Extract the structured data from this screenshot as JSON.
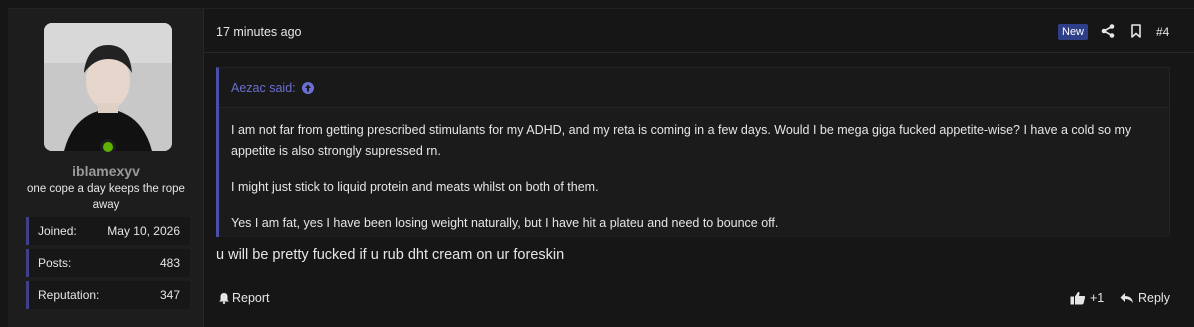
{
  "user": {
    "username": "iblamexyv",
    "title": "one cope a day keeps the rope away",
    "stats": [
      {
        "label": "Joined:",
        "value": "May 10, 2026"
      },
      {
        "label": "Posts:",
        "value": "483"
      },
      {
        "label": "Reputation:",
        "value": "347"
      }
    ]
  },
  "header": {
    "time": "17 minutes ago",
    "badge": "New",
    "post_number": "#4",
    "icons": [
      "share-icon",
      "bookmark-icon"
    ]
  },
  "quote": {
    "author_label": "Aezac said:",
    "paragraphs": [
      "I am not far from getting prescribed stimulants for my ADHD, and my reta is coming in a few days. Would I be mega giga fucked appetite-wise? I have a cold so my appetite is also strongly supressed rn.",
      "I might just stick to liquid protein and meats whilst on both of them.",
      "Yes I am fat, yes I have been losing weight naturally, but I have hit a plateu and need to bounce off."
    ]
  },
  "reply": {
    "text": "u will be pretty fucked if u rub dht cream on ur foreskin"
  },
  "footer": {
    "report_label": "Report",
    "like_label": "+1",
    "reply_label": "Reply"
  },
  "colors": {
    "accent": "#4b4fa8",
    "badge_bg": "#2f3e88",
    "online": "#5fb300"
  }
}
